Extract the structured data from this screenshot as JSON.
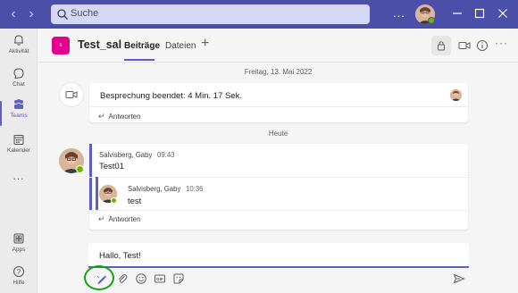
{
  "titlebar": {
    "search_placeholder": "Suche",
    "more_label": "...",
    "accent_color": "#4b4fa8"
  },
  "rail": {
    "items": [
      {
        "label": "Aktivität",
        "icon": "bell-icon"
      },
      {
        "label": "Chat",
        "icon": "chat-icon"
      },
      {
        "label": "Teams",
        "icon": "teams-icon"
      },
      {
        "label": "Kalender",
        "icon": "calendar-icon"
      },
      {
        "label": "...",
        "icon": "more-icon"
      },
      {
        "label": "Apps",
        "icon": "apps-icon"
      },
      {
        "label": "Hilfe",
        "icon": "help-icon"
      }
    ],
    "active_index": 2
  },
  "header": {
    "team_icon_text": "s",
    "team_name": "Test_sal",
    "tabs": [
      {
        "label": "Beiträge",
        "active": true
      },
      {
        "label": "Dateien",
        "active": false
      }
    ],
    "add_tab_label": "+"
  },
  "feed": {
    "date_1": "Freitag, 13. Mai 2022",
    "meeting": {
      "title": "Besprechung beendet: 4 Min. 17 Sek.",
      "reply_label": "Antworten"
    },
    "date_2": "Heute",
    "post": {
      "author": "Salvisberg, Gaby",
      "time": "09:43",
      "text": "Test01",
      "reply": {
        "author": "Salvisberg, Gaby",
        "time": "10:36",
        "text": "test"
      },
      "reply_label": "Antworten"
    }
  },
  "compose": {
    "text": "Hallo, Test!"
  },
  "colors": {
    "brand": "#5b5fc7",
    "team_icon": "#e3008c",
    "presence": "#6bb700",
    "highlight_circle": "#13a10e"
  }
}
